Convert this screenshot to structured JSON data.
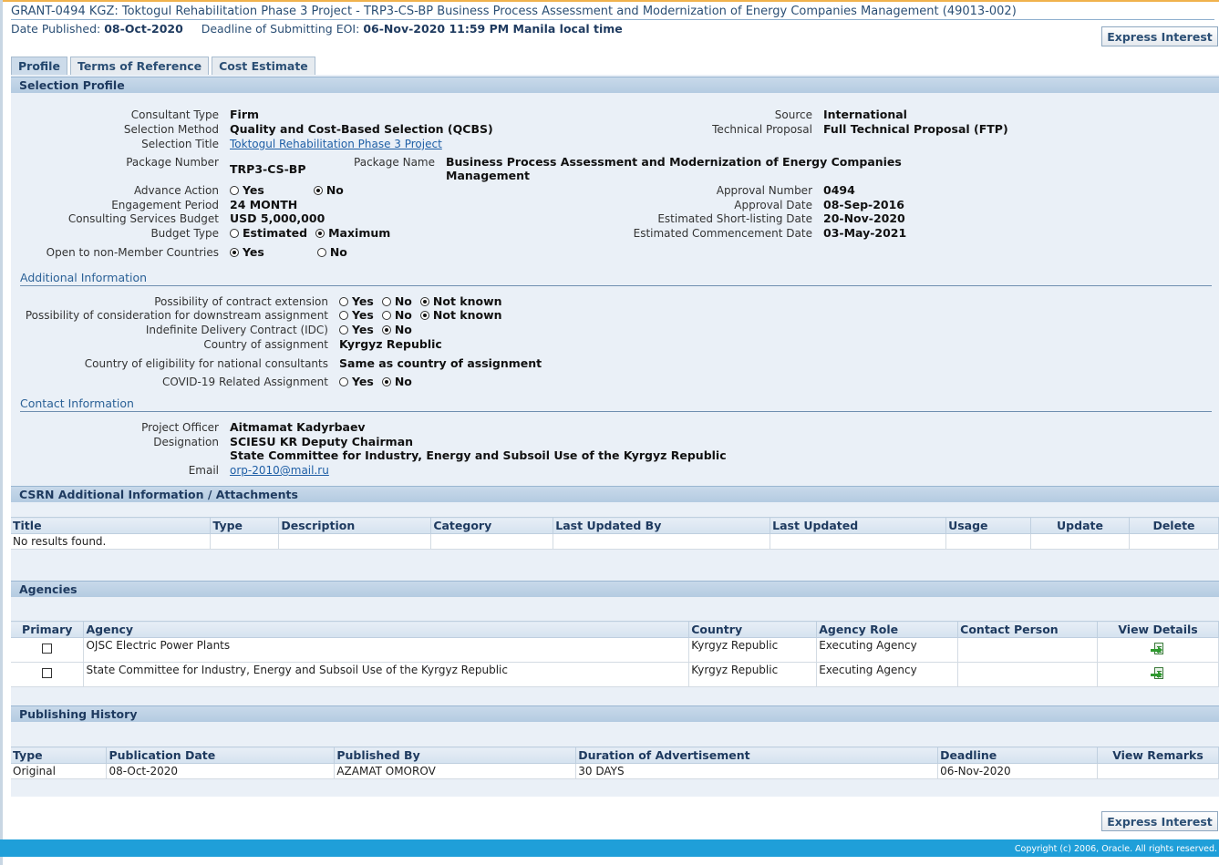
{
  "header": {
    "title": "GRANT-0494 KGZ: Toktogul Rehabilitation Phase 3 Project - TRP3-CS-BP Business Process Assessment and Modernization of Energy Companies Management (49013-002)",
    "date_published_label": "Date Published:",
    "date_published": "08-Oct-2020",
    "deadline_label": "Deadline of Submitting EOI:",
    "deadline": "06-Nov-2020 11:59 PM Manila local time",
    "express_interest_label": "Express Interest"
  },
  "tabs": [
    {
      "label": "Profile",
      "active": true
    },
    {
      "label": "Terms of Reference",
      "active": false
    },
    {
      "label": "Cost Estimate",
      "active": false
    }
  ],
  "selection_profile": {
    "heading": "Selection Profile",
    "consultant_type_label": "Consultant Type",
    "consultant_type": "Firm",
    "selection_method_label": "Selection Method",
    "selection_method": "Quality and Cost-Based Selection (QCBS)",
    "selection_title_label": "Selection Title",
    "selection_title": "Toktogul Rehabilitation Phase 3 Project",
    "package_number_label": "Package Number",
    "package_number": "TRP3-CS-BP",
    "package_name_label": "Package Name",
    "package_name_line1": "Business Process Assessment and Modernization of Energy Companies",
    "package_name_line2": "Management",
    "advance_action_label": "Advance Action",
    "engagement_period_label": "Engagement Period",
    "engagement_period": "24 MONTH",
    "budget_label": "Consulting Services Budget",
    "budget": "USD 5,000,000",
    "budget_type_label": "Budget Type",
    "budget_type_estimated": "Estimated",
    "budget_type_maximum": "Maximum",
    "open_label": "Open to non-Member Countries",
    "yes": "Yes",
    "no": "No",
    "source_label": "Source",
    "source": "International",
    "technical_proposal_label": "Technical Proposal",
    "technical_proposal": "Full Technical Proposal (FTP)",
    "approval_number_label": "Approval Number",
    "approval_number": "0494",
    "approval_date_label": "Approval Date",
    "approval_date": "08-Sep-2016",
    "shortlisting_label": "Estimated Short-listing Date",
    "shortlisting": "20-Nov-2020",
    "commencement_label": "Estimated Commencement Date",
    "commencement": "03-May-2021"
  },
  "additional_info": {
    "heading": "Additional Information",
    "extension_label": "Possibility of contract extension",
    "downstream_label": "Possibility of consideration for downstream assignment",
    "idc_label": "Indefinite Delivery Contract (IDC)",
    "country_label": "Country of assignment",
    "country": "Kyrgyz Republic",
    "eligibility_label": "Country of eligibility for national consultants",
    "eligibility": "Same as country of assignment",
    "covid_label": "COVID-19 Related Assignment",
    "yes": "Yes",
    "no": "No",
    "not_known": "Not known"
  },
  "contact_info": {
    "heading": "Contact Information",
    "officer_label": "Project Officer",
    "officer": "Aitmamat Kadyrbaev",
    "designation_label": "Designation",
    "designation_line1": "SCIESU KR Deputy Chairman",
    "designation_line2": "State Committee for Industry, Energy and Subsoil Use of the Kyrgyz Republic",
    "email_label": "Email",
    "email": "orp-2010@mail.ru"
  },
  "attachments": {
    "heading": "CSRN Additional Information / Attachments",
    "columns": [
      "Title",
      "Type",
      "Description",
      "Category",
      "Last Updated By",
      "Last Updated",
      "Usage",
      "Update",
      "Delete"
    ],
    "empty_text": "No results found."
  },
  "agencies": {
    "heading": "Agencies",
    "columns": [
      "Primary",
      "Agency",
      "Country",
      "Agency Role",
      "Contact Person",
      "View Details"
    ],
    "rows": [
      {
        "agency": "OJSC Electric Power Plants",
        "country": "Kyrgyz Republic",
        "role": "Executing Agency",
        "contact": ""
      },
      {
        "agency": "State Committee for Industry, Energy and Subsoil Use of the Kyrgyz Republic",
        "country": "Kyrgyz Republic",
        "role": "Executing Agency",
        "contact": ""
      }
    ]
  },
  "publishing_history": {
    "heading": "Publishing History",
    "columns": [
      "Type",
      "Publication Date",
      "Published By",
      "Duration of Advertisement",
      "Deadline",
      "View Remarks"
    ],
    "rows": [
      {
        "type": "Original",
        "pub_date": "08-Oct-2020",
        "published_by": "AZAMAT OMOROV",
        "duration": "30 DAYS",
        "deadline": "06-Nov-2020",
        "remarks": ""
      }
    ]
  },
  "footer": {
    "copyright": "Copyright (c) 2006, Oracle. All rights reserved."
  }
}
